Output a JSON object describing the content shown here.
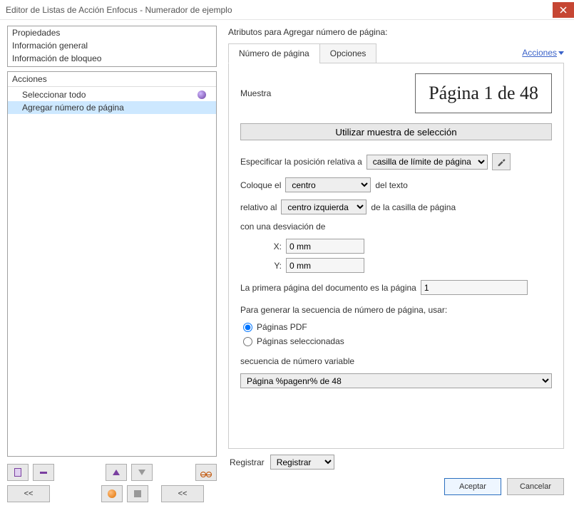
{
  "window": {
    "title": "Editor de Listas de Acción Enfocus - Numerador de ejemplo"
  },
  "propsList": {
    "items": [
      "Propiedades",
      "Información general",
      "Información de bloqueo"
    ]
  },
  "actionsBox": {
    "header": "Acciones",
    "items": [
      {
        "label": "Seleccionar todo",
        "selected": false,
        "dot": true
      },
      {
        "label": "Agregar número de página",
        "selected": true,
        "dot": false
      }
    ]
  },
  "leftTools": {
    "doc": "",
    "minus": "",
    "up": "",
    "down": "",
    "glasses": "",
    "rewind1": "<<",
    "record": "",
    "stop": "",
    "rewind2": "<<"
  },
  "rightPanel": {
    "heading": "Atributos para Agregar número de página:",
    "tabs": {
      "tab1": "Número de página",
      "tab2": "Opciones"
    },
    "actionsLink": "Acciones",
    "muestraLabel": "Muestra",
    "previewText": "Página 1 de 48",
    "useSelectionBtn": "Utilizar muestra de selección",
    "specPosLabel": "Especificar la posición relativa a",
    "specPosSelect": "casilla de límite de página",
    "placeLabel": "Coloque el",
    "placeSelect": "centro",
    "placeAfter": "del texto",
    "relLabel": "relativo al",
    "relSelect": "centro izquierda",
    "relAfter": "de la casilla de página",
    "deviationLabel": "con una desviación de",
    "xLabel": "X:",
    "xValue": "0 mm",
    "yLabel": "Y:",
    "yValue": "0 mm",
    "firstPageLabel": "La primera página del documento es la página",
    "firstPageValue": "1",
    "seqGenLabel": "Para generar la secuencia de número de página, usar:",
    "radio1": "Páginas PDF",
    "radio2": "Páginas seleccionadas",
    "varSeqLabel": "secuencia de número variable",
    "varSeqSelect": "Página %pagenr% de 48",
    "registrarLabel": "Registrar",
    "registrarSelect": "Registrar"
  },
  "footer": {
    "ok": "Aceptar",
    "cancel": "Cancelar"
  }
}
